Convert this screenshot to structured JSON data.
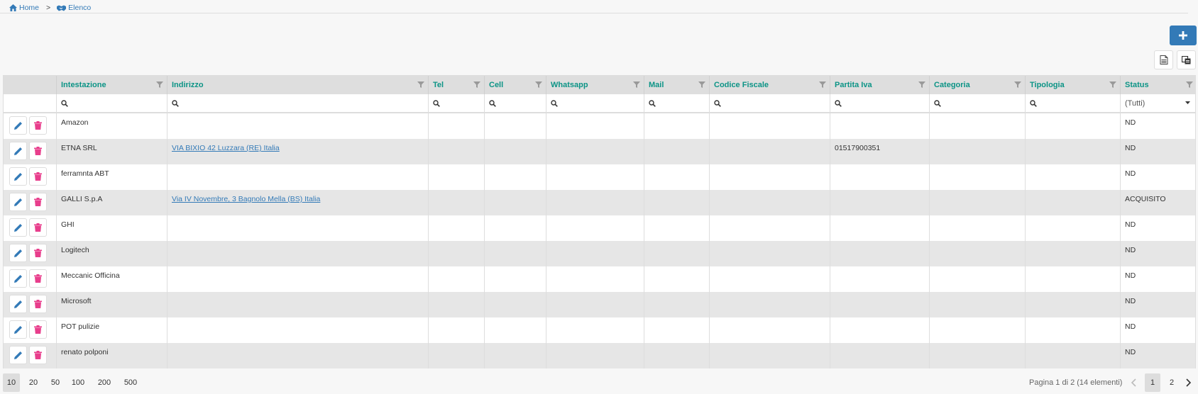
{
  "breadcrumb": {
    "home": "Home",
    "separator": ">",
    "current": "Elenco"
  },
  "toolbar": {
    "add_icon": "plus-icon",
    "export_icon": "export-excel-icon",
    "columns_icon": "column-chooser-icon"
  },
  "colors": {
    "accent": "#337ab7",
    "header_text": "#0c9486",
    "delete": "#e83e8c"
  },
  "columns": [
    "Intestazione",
    "Indirizzo",
    "Tel",
    "Cell",
    "Whatsapp",
    "Mail",
    "Codice Fiscale",
    "Partita Iva",
    "Categoria",
    "Tipologia",
    "Status"
  ],
  "filter": {
    "status_value": "(Tutti)"
  },
  "rows": [
    {
      "intestazione": "Amazon",
      "indirizzo": "",
      "piva": "",
      "status": "ND"
    },
    {
      "intestazione": "ETNA SRL",
      "indirizzo": "VIA BIXIO 42 Luzzara (RE) Italia",
      "piva": "01517900351",
      "status": "ND"
    },
    {
      "intestazione": "ferramnta ABT",
      "indirizzo": "",
      "piva": "",
      "status": "ND"
    },
    {
      "intestazione": "GALLI S.p.A",
      "indirizzo": "Via IV Novembre, 3 Bagnolo Mella (BS) Italia",
      "piva": "",
      "status": "ACQUISITO"
    },
    {
      "intestazione": "GHI",
      "indirizzo": "",
      "piva": "",
      "status": "ND"
    },
    {
      "intestazione": "Logitech",
      "indirizzo": "",
      "piva": "",
      "status": "ND"
    },
    {
      "intestazione": "Meccanic Officina",
      "indirizzo": "",
      "piva": "",
      "status": "ND"
    },
    {
      "intestazione": "Microsoft",
      "indirizzo": "",
      "piva": "",
      "status": "ND"
    },
    {
      "intestazione": "POT pulizie",
      "indirizzo": "",
      "piva": "",
      "status": "ND"
    },
    {
      "intestazione": "renato polponi",
      "indirizzo": "",
      "piva": "",
      "status": "ND"
    }
  ],
  "pager": {
    "sizes": [
      "10",
      "20",
      "50",
      "100",
      "200",
      "500"
    ],
    "selected_size": "10",
    "info": "Pagina 1 di 2 (14 elementi)",
    "pages": [
      "1",
      "2"
    ],
    "current_page": "1"
  }
}
